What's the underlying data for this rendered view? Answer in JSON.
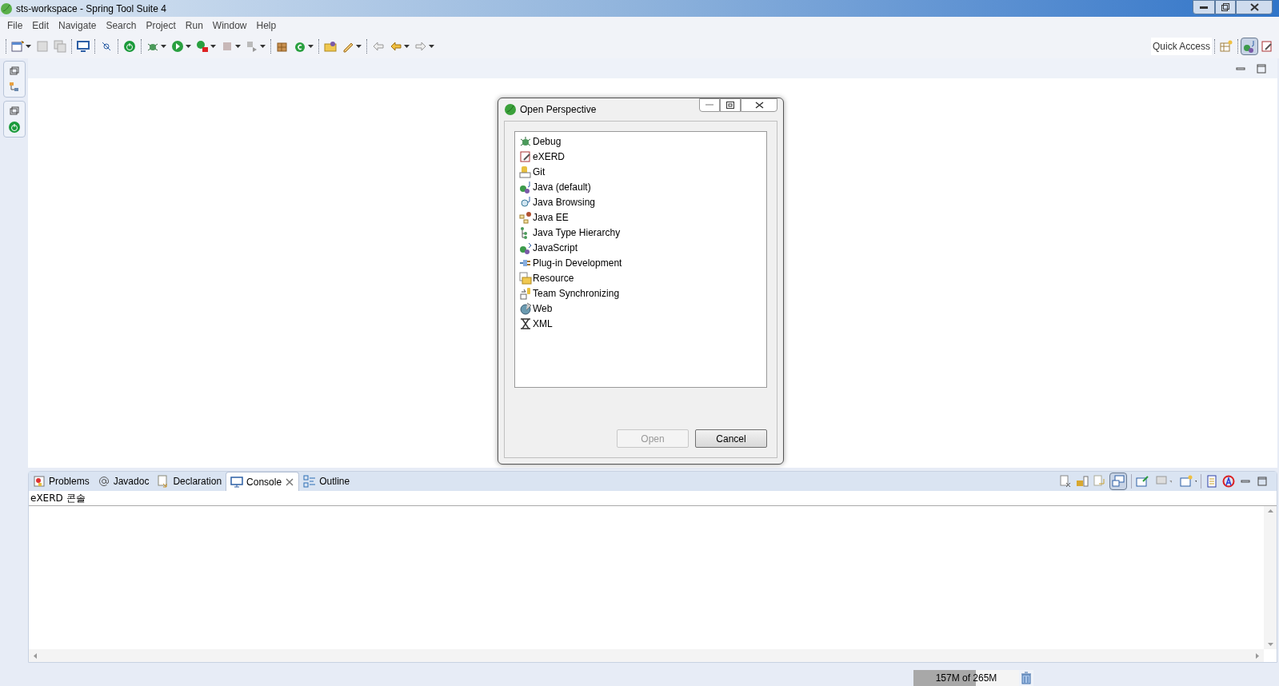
{
  "window": {
    "title": "sts-workspace - Spring Tool Suite 4"
  },
  "menu": [
    "File",
    "Edit",
    "Navigate",
    "Search",
    "Project",
    "Run",
    "Window",
    "Help"
  ],
  "quick_access": {
    "placeholder": "Quick Access"
  },
  "dialog": {
    "title": "Open Perspective",
    "perspectives": [
      {
        "label": "Debug",
        "selected": false
      },
      {
        "label": "eXERD",
        "selected": false
      },
      {
        "label": "Git",
        "selected": false
      },
      {
        "label": "Java (default)",
        "selected": false
      },
      {
        "label": "Java Browsing",
        "selected": false
      },
      {
        "label": "Java EE",
        "selected": false
      },
      {
        "label": "Java Type Hierarchy",
        "selected": false
      },
      {
        "label": "JavaScript",
        "selected": false
      },
      {
        "label": "Plug-in Development",
        "selected": false
      },
      {
        "label": "Resource",
        "selected": false
      },
      {
        "label": "Team Synchronizing",
        "selected": false
      },
      {
        "label": "Web",
        "selected": false
      },
      {
        "label": "XML",
        "selected": false
      }
    ],
    "buttons": [
      {
        "label": "Open",
        "disabled": true
      },
      {
        "label": "Cancel",
        "disabled": false
      }
    ]
  },
  "panel": {
    "tabs": [
      {
        "label": "Problems",
        "selected": false,
        "closable": false
      },
      {
        "label": "Javadoc",
        "selected": false,
        "closable": false
      },
      {
        "label": "Declaration",
        "selected": false,
        "closable": false
      },
      {
        "label": "Console",
        "selected": true,
        "closable": true
      },
      {
        "label": "Outline",
        "selected": false,
        "closable": false
      }
    ],
    "console_title": "eXERD 콘솔"
  },
  "status_bar": {
    "heap": {
      "text": "157M of 265M",
      "level": 0.59
    }
  }
}
